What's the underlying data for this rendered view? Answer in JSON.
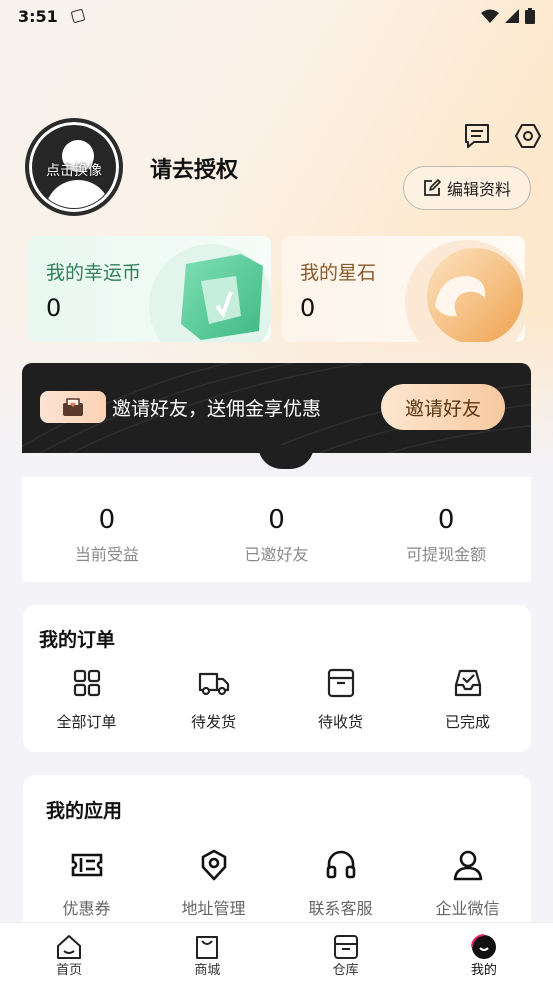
{
  "status_bar": {
    "time": "3:51"
  },
  "profile": {
    "avatar_label": "点击换像",
    "username": "请去授权",
    "edit_label": "编辑资料"
  },
  "cards": {
    "lucky": {
      "title": "我的幸运币",
      "value": "0"
    },
    "star": {
      "title": "我的星石",
      "value": "0"
    }
  },
  "invite": {
    "text": "邀请好友，送佣金享优惠",
    "button_label": "邀请好友"
  },
  "earnings": [
    {
      "value": "0",
      "label": "当前受益"
    },
    {
      "value": "0",
      "label": "已邀好友"
    },
    {
      "value": "0",
      "label": "可提现金额"
    }
  ],
  "orders": {
    "title": "我的订单",
    "items": [
      {
        "label": "全部订单",
        "icon": "grid-icon"
      },
      {
        "label": "待发货",
        "icon": "truck-icon"
      },
      {
        "label": "待收货",
        "icon": "box-icon"
      },
      {
        "label": "已完成",
        "icon": "inbox-check-icon"
      }
    ]
  },
  "apps": {
    "title": "我的应用",
    "items": [
      {
        "label": "优惠券",
        "icon": "ticket-icon"
      },
      {
        "label": "地址管理",
        "icon": "location-icon"
      },
      {
        "label": "联系客服",
        "icon": "headphones-icon"
      },
      {
        "label": "企业微信",
        "icon": "person-icon"
      }
    ]
  },
  "tabbar": [
    {
      "label": "首页",
      "icon": "home-icon"
    },
    {
      "label": "商城",
      "icon": "bag-icon"
    },
    {
      "label": "仓库",
      "icon": "warehouse-icon"
    },
    {
      "label": "我的",
      "icon": "profile-icon",
      "active": true
    }
  ]
}
